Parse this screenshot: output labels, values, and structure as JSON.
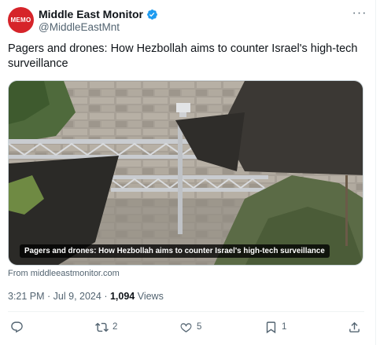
{
  "author": {
    "name": "Middle East Monitor",
    "handle": "@MiddleEastMnt",
    "avatar_text": "MEMO",
    "verified_icon": "verified-badge-icon"
  },
  "tweet": {
    "text": "Pagers and drones: How Hezbollah aims to counter Israel's high-tech surveillance"
  },
  "media": {
    "caption": "Pagers and drones: How Hezbollah aims to counter Israel's high-tech surveillance",
    "source": "From middleeastmonitor.com"
  },
  "meta": {
    "time": "3:21 PM",
    "sep1": " · ",
    "date": "Jul 9, 2024",
    "sep2": " · ",
    "views_count": "1,094",
    "views_label": " Views"
  },
  "actions": {
    "reply_count": "",
    "retweet_count": "2",
    "like_count": "5",
    "bookmark_count": "1"
  },
  "colors": {
    "brand_red": "#d6242a",
    "verified_blue": "#1d9bf0",
    "secondary_text": "#536471"
  }
}
